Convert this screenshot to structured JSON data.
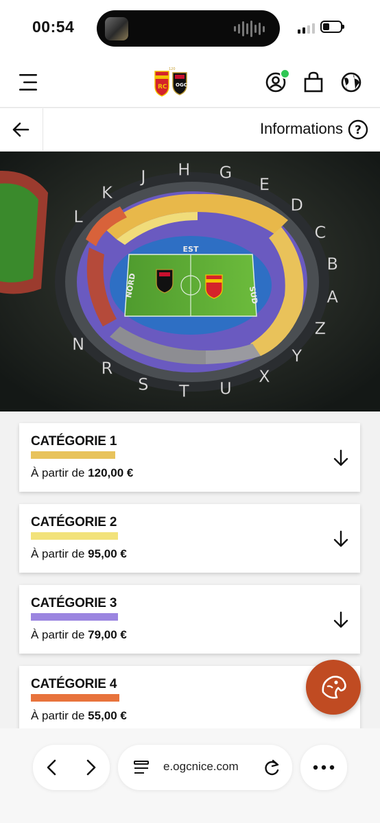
{
  "status": {
    "time": "00:54"
  },
  "header": {
    "online_color": "#2fc654"
  },
  "subbar": {
    "info_label": "Informations"
  },
  "stadium": {
    "block_letters": [
      "L",
      "K",
      "J",
      "H",
      "G",
      "E",
      "D",
      "C",
      "B",
      "A",
      "Z",
      "Y",
      "X",
      "U",
      "T",
      "S",
      "R",
      "N"
    ],
    "stand_labels": {
      "north": "NORD",
      "east": "EST",
      "south": "SUD"
    }
  },
  "categories": [
    {
      "title": "CATÉGORIE 1",
      "price_prefix": "À partir de",
      "price": "120,00 €",
      "color": "#e8c35c"
    },
    {
      "title": "CATÉGORIE 2",
      "price_prefix": "À partir de",
      "price": "95,00 €",
      "color": "#f2e27a"
    },
    {
      "title": "CATÉGORIE 3",
      "price_prefix": "À partir de",
      "price": "79,00 €",
      "color": "#9b85e0"
    },
    {
      "title": "CATÉGORIE 4",
      "price_prefix": "À partir de",
      "price": "55,00 €",
      "color": "#e8733c"
    }
  ],
  "browser": {
    "url": "e.ogcnice.com"
  }
}
